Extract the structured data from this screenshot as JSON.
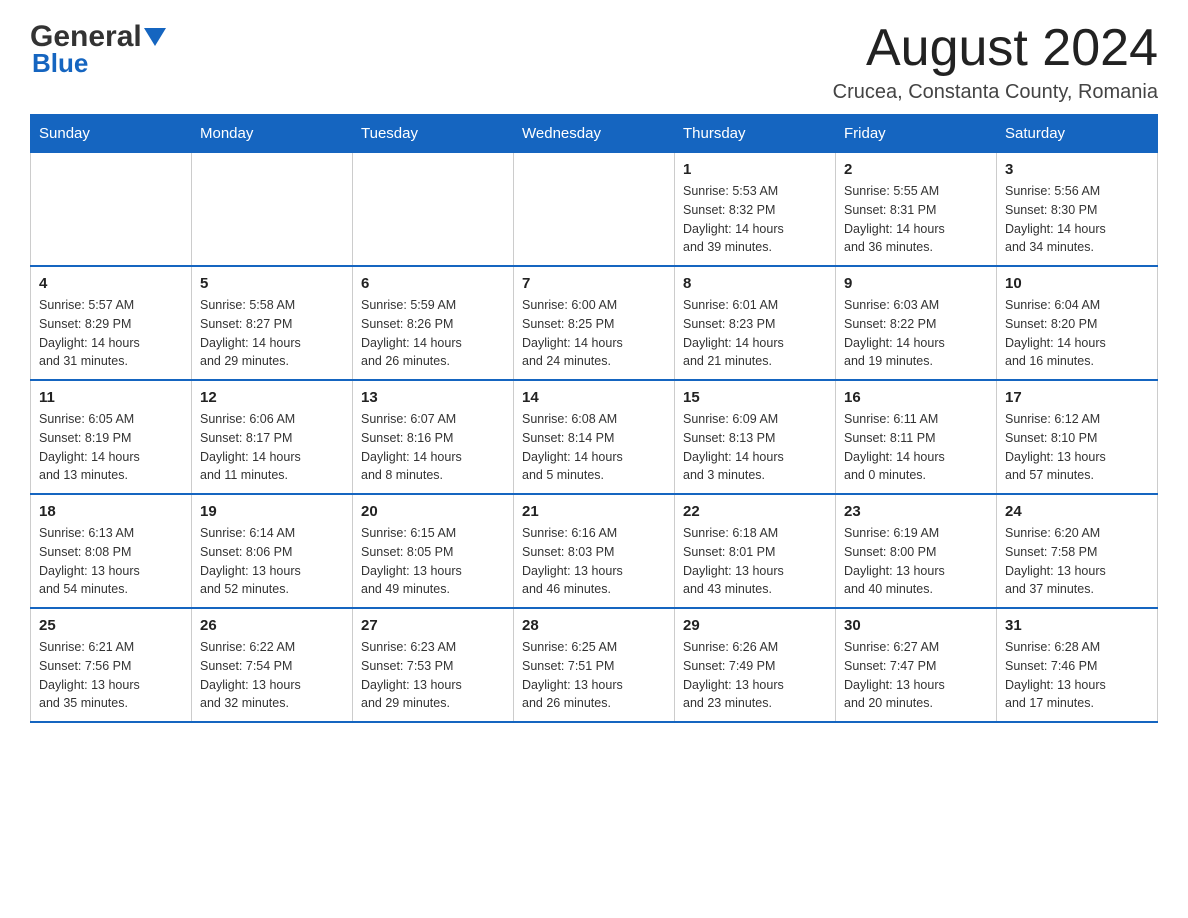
{
  "header": {
    "logo_general": "General",
    "logo_blue": "Blue",
    "title": "August 2024",
    "subtitle": "Crucea, Constanta County, Romania"
  },
  "days_of_week": [
    "Sunday",
    "Monday",
    "Tuesday",
    "Wednesday",
    "Thursday",
    "Friday",
    "Saturday"
  ],
  "weeks": [
    [
      {
        "day": "",
        "info": ""
      },
      {
        "day": "",
        "info": ""
      },
      {
        "day": "",
        "info": ""
      },
      {
        "day": "",
        "info": ""
      },
      {
        "day": "1",
        "info": "Sunrise: 5:53 AM\nSunset: 8:32 PM\nDaylight: 14 hours\nand 39 minutes."
      },
      {
        "day": "2",
        "info": "Sunrise: 5:55 AM\nSunset: 8:31 PM\nDaylight: 14 hours\nand 36 minutes."
      },
      {
        "day": "3",
        "info": "Sunrise: 5:56 AM\nSunset: 8:30 PM\nDaylight: 14 hours\nand 34 minutes."
      }
    ],
    [
      {
        "day": "4",
        "info": "Sunrise: 5:57 AM\nSunset: 8:29 PM\nDaylight: 14 hours\nand 31 minutes."
      },
      {
        "day": "5",
        "info": "Sunrise: 5:58 AM\nSunset: 8:27 PM\nDaylight: 14 hours\nand 29 minutes."
      },
      {
        "day": "6",
        "info": "Sunrise: 5:59 AM\nSunset: 8:26 PM\nDaylight: 14 hours\nand 26 minutes."
      },
      {
        "day": "7",
        "info": "Sunrise: 6:00 AM\nSunset: 8:25 PM\nDaylight: 14 hours\nand 24 minutes."
      },
      {
        "day": "8",
        "info": "Sunrise: 6:01 AM\nSunset: 8:23 PM\nDaylight: 14 hours\nand 21 minutes."
      },
      {
        "day": "9",
        "info": "Sunrise: 6:03 AM\nSunset: 8:22 PM\nDaylight: 14 hours\nand 19 minutes."
      },
      {
        "day": "10",
        "info": "Sunrise: 6:04 AM\nSunset: 8:20 PM\nDaylight: 14 hours\nand 16 minutes."
      }
    ],
    [
      {
        "day": "11",
        "info": "Sunrise: 6:05 AM\nSunset: 8:19 PM\nDaylight: 14 hours\nand 13 minutes."
      },
      {
        "day": "12",
        "info": "Sunrise: 6:06 AM\nSunset: 8:17 PM\nDaylight: 14 hours\nand 11 minutes."
      },
      {
        "day": "13",
        "info": "Sunrise: 6:07 AM\nSunset: 8:16 PM\nDaylight: 14 hours\nand 8 minutes."
      },
      {
        "day": "14",
        "info": "Sunrise: 6:08 AM\nSunset: 8:14 PM\nDaylight: 14 hours\nand 5 minutes."
      },
      {
        "day": "15",
        "info": "Sunrise: 6:09 AM\nSunset: 8:13 PM\nDaylight: 14 hours\nand 3 minutes."
      },
      {
        "day": "16",
        "info": "Sunrise: 6:11 AM\nSunset: 8:11 PM\nDaylight: 14 hours\nand 0 minutes."
      },
      {
        "day": "17",
        "info": "Sunrise: 6:12 AM\nSunset: 8:10 PM\nDaylight: 13 hours\nand 57 minutes."
      }
    ],
    [
      {
        "day": "18",
        "info": "Sunrise: 6:13 AM\nSunset: 8:08 PM\nDaylight: 13 hours\nand 54 minutes."
      },
      {
        "day": "19",
        "info": "Sunrise: 6:14 AM\nSunset: 8:06 PM\nDaylight: 13 hours\nand 52 minutes."
      },
      {
        "day": "20",
        "info": "Sunrise: 6:15 AM\nSunset: 8:05 PM\nDaylight: 13 hours\nand 49 minutes."
      },
      {
        "day": "21",
        "info": "Sunrise: 6:16 AM\nSunset: 8:03 PM\nDaylight: 13 hours\nand 46 minutes."
      },
      {
        "day": "22",
        "info": "Sunrise: 6:18 AM\nSunset: 8:01 PM\nDaylight: 13 hours\nand 43 minutes."
      },
      {
        "day": "23",
        "info": "Sunrise: 6:19 AM\nSunset: 8:00 PM\nDaylight: 13 hours\nand 40 minutes."
      },
      {
        "day": "24",
        "info": "Sunrise: 6:20 AM\nSunset: 7:58 PM\nDaylight: 13 hours\nand 37 minutes."
      }
    ],
    [
      {
        "day": "25",
        "info": "Sunrise: 6:21 AM\nSunset: 7:56 PM\nDaylight: 13 hours\nand 35 minutes."
      },
      {
        "day": "26",
        "info": "Sunrise: 6:22 AM\nSunset: 7:54 PM\nDaylight: 13 hours\nand 32 minutes."
      },
      {
        "day": "27",
        "info": "Sunrise: 6:23 AM\nSunset: 7:53 PM\nDaylight: 13 hours\nand 29 minutes."
      },
      {
        "day": "28",
        "info": "Sunrise: 6:25 AM\nSunset: 7:51 PM\nDaylight: 13 hours\nand 26 minutes."
      },
      {
        "day": "29",
        "info": "Sunrise: 6:26 AM\nSunset: 7:49 PM\nDaylight: 13 hours\nand 23 minutes."
      },
      {
        "day": "30",
        "info": "Sunrise: 6:27 AM\nSunset: 7:47 PM\nDaylight: 13 hours\nand 20 minutes."
      },
      {
        "day": "31",
        "info": "Sunrise: 6:28 AM\nSunset: 7:46 PM\nDaylight: 13 hours\nand 17 minutes."
      }
    ]
  ]
}
